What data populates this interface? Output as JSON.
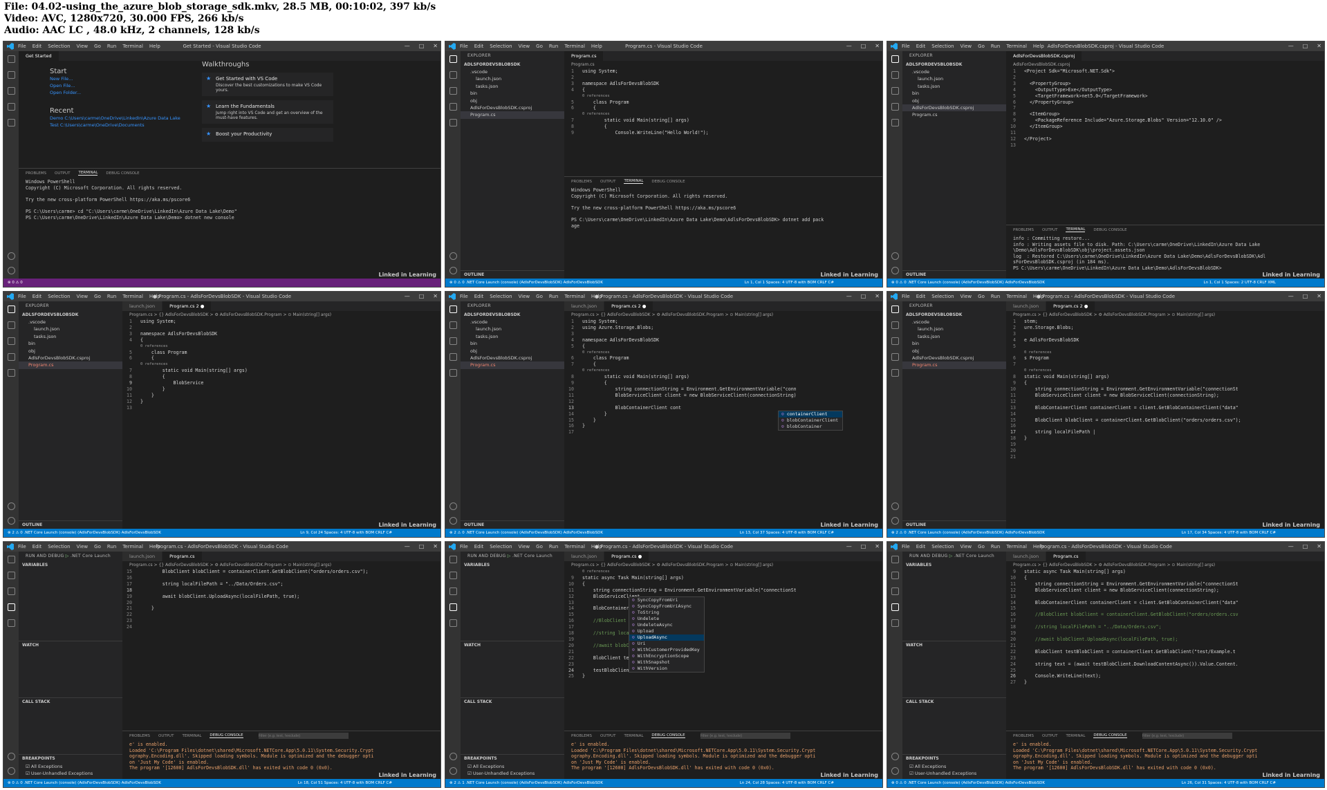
{
  "header": {
    "lines": [
      "File: 04.02-using_the_azure_blob_storage_sdk.mkv, 28.5 MB, 00:10:02, 397 kb/s",
      "Video: AVC, 1280x720, 30.000 FPS, 266 kb/s",
      "Audio: AAC LC , 48.0 kHz, 2 channels, 128 kb/s"
    ]
  },
  "menu": [
    "File",
    "Edit",
    "Selection",
    "View",
    "Go",
    "Run",
    "Terminal",
    "Help"
  ],
  "watermark": "Linked in Learning",
  "panels": [
    {
      "title": "Get Started - Visual Studio Code",
      "tabs": [
        "Get Started"
      ],
      "welcome": {
        "start_heading": "Start",
        "start_links": [
          "New File...",
          "Open File...",
          "Open Folder..."
        ],
        "recent_heading": "Recent",
        "recent": [
          "Demo   C:\\Users\\carme\\OneDrive\\LinkedIn\\Azure Data Lake",
          "Test   C:\\Users\\carme\\OneDrive\\Documents"
        ],
        "walkthroughs_heading": "Walkthroughs",
        "cards": [
          {
            "title": "Get Started with VS Code",
            "desc": "Discover the best customizations to make VS Code yours."
          },
          {
            "title": "Learn the Fundamentals",
            "desc": "Jump right into VS Code and get an overview of the must-have features."
          },
          {
            "title": "Boost your Productivity",
            "desc": ""
          }
        ]
      },
      "panel_tabs": [
        "PROBLEMS",
        "OUTPUT",
        "TERMINAL",
        "DEBUG CONSOLE"
      ],
      "terminal": [
        "Windows PowerShell",
        "Copyright (C) Microsoft Corporation. All rights reserved.",
        "",
        "Try the new cross-platform PowerShell https://aka.ms/pscore6",
        "",
        "PS C:\\Users\\carme> cd \"C:\\Users\\carme\\OneDrive\\LinkedIn\\Azure Data Lake\\Demo\"",
        "PS C:\\Users\\carme\\OneDrive\\LinkedIn\\Azure Data Lake\\Demo> dotnet new console"
      ],
      "status": "⊗ 0 ⚠ 0"
    },
    {
      "title": "Program.cs - Visual Studio Code",
      "explorer_title": "EXPLORER",
      "folder": "ADLSFORDEVSBLOBSDK",
      "files": [
        ".vscode",
        "launch.json",
        "tasks.json",
        "bin",
        "obj",
        "AdlsForDevsBlobSDK.csproj",
        "Program.cs"
      ],
      "tabs": [
        "Program.cs"
      ],
      "breadcrumb": "Program.cs",
      "code": [
        [
          "1",
          "using System;"
        ],
        [
          "2",
          ""
        ],
        [
          "3",
          "namespace AdlsForDevsBlobSDK"
        ],
        [
          "4",
          "{"
        ],
        [
          "",
          "0 references"
        ],
        [
          "5",
          "    class Program"
        ],
        [
          "6",
          "    {"
        ],
        [
          "",
          "0 references"
        ],
        [
          "7",
          "        static void Main(string[] args)"
        ],
        [
          "8",
          "        {"
        ],
        [
          "9",
          "            Console.WriteLine(\"Hello World!\");"
        ]
      ],
      "panel_tabs": [
        "PROBLEMS",
        "OUTPUT",
        "TERMINAL",
        "DEBUG CONSOLE"
      ],
      "terminal": [
        "Windows PowerShell",
        "Copyright (C) Microsoft Corporation. All rights reserved.",
        "",
        "Try the new cross-platform PowerShell https://aka.ms/pscore6",
        "",
        "PS C:\\Users\\carme\\OneDrive\\LinkedIn\\Azure Data Lake\\Demo\\AdlsForDevsBlobSDK> dotnet add pack",
        "age"
      ],
      "outline": "OUTLINE",
      "status": "⊗ 0 ⚠ 0   .NET Core Launch (console) (AdlsForDevsBlobSDK)   AdlsForDevsBlobSDK",
      "status_right": "Ln 1, Col 1   Spaces: 4   UTF-8 with BOM   CRLF   C#"
    },
    {
      "title": "AdlsForDevsBlobSDK.csproj - Visual Studio Code",
      "explorer_title": "EXPLORER",
      "folder": "ADLSFORDEVSBLOBSDK",
      "files": [
        ".vscode",
        "launch.json",
        "tasks.json",
        "bin",
        "obj",
        "AdlsForDevsBlobSDK.csproj",
        "Program.cs"
      ],
      "tabs": [
        "AdlsForDevsBlobSDK.csproj"
      ],
      "breadcrumb": "AdlsForDevsBlobSDK.csproj",
      "code": [
        [
          "1",
          "<Project Sdk=\"Microsoft.NET.Sdk\">"
        ],
        [
          "2",
          ""
        ],
        [
          "3",
          "  <PropertyGroup>"
        ],
        [
          "4",
          "    <OutputType>Exe</OutputType>"
        ],
        [
          "5",
          "    <TargetFramework>net5.0</TargetFramework>"
        ],
        [
          "6",
          "  </PropertyGroup>"
        ],
        [
          "7",
          ""
        ],
        [
          "8",
          "  <ItemGroup>"
        ],
        [
          "9",
          "    <PackageReference Include=\"Azure.Storage.Blobs\" Version=\"12.10.0\" />"
        ],
        [
          "10",
          "  </ItemGroup>"
        ],
        [
          "11",
          ""
        ],
        [
          "12",
          "</Project>"
        ],
        [
          "13",
          ""
        ]
      ],
      "panel_tabs": [
        "PROBLEMS",
        "OUTPUT",
        "TERMINAL",
        "DEBUG CONSOLE"
      ],
      "terminal": [
        "info : Committing restore...",
        "info : Writing assets file to disk. Path: C:\\Users\\carme\\OneDrive\\LinkedIn\\Azure Data Lake",
        "\\Demo\\AdlsForDevsBlobSDK\\obj\\project.assets.json",
        "log  : Restored C:\\Users\\carme\\OneDrive\\LinkedIn\\Azure Data Lake\\Demo\\AdlsForDevsBlobSDK\\Adl",
        "sForDevsBlobSDK.csproj (in 184 ms).",
        "PS C:\\Users\\carme\\OneDrive\\LinkedIn\\Azure Data Lake\\Demo\\AdlsForDevsBlobSDK>"
      ],
      "outline": "OUTLINE",
      "status": "⊗ 0 ⚠ 0   .NET Core Launch (console) (AdlsForDevsBlobSDK)   AdlsForDevsBlobSDK",
      "status_right": "Ln 1, Col 1   Spaces: 2   UTF-8   CRLF   XML"
    },
    {
      "title": "● Program.cs - AdlsForDevsBlobSDK - Visual Studio Code",
      "explorer_title": "EXPLORER",
      "folder": "ADLSFORDEVSBLOBSDK",
      "files": [
        ".vscode",
        "launch.json",
        "tasks.json",
        "bin",
        "obj",
        "AdlsForDevsBlobSDK.csproj",
        "Program.cs"
      ],
      "tabs": [
        "launch.json",
        "Program.cs 2 ●"
      ],
      "breadcrumb": "Program.cs > {} AdlsForDevsBlobSDK > ⚙ AdlsForDevsBlobSDK.Program > ⊙ Main(string[] args)",
      "code": [
        [
          "1",
          "using System;"
        ],
        [
          "2",
          ""
        ],
        [
          "3",
          "namespace AdlsForDevsBlobSDK"
        ],
        [
          "4",
          "{"
        ],
        [
          "",
          "0 references"
        ],
        [
          "5",
          "    class Program"
        ],
        [
          "6",
          "    {"
        ],
        [
          "",
          "0 references"
        ],
        [
          "7",
          "        static void Main(string[] args)"
        ],
        [
          "8",
          "        {"
        ],
        [
          "9",
          "            BlobService"
        ],
        [
          "10",
          "        }"
        ],
        [
          "11",
          "    }"
        ],
        [
          "12",
          "}"
        ],
        [
          "13",
          ""
        ]
      ],
      "outline": "OUTLINE",
      "status": "⊗ 2 ⚠ 0   .NET Core Launch (console) (AdlsForDevsBlobSDK)   AdlsForDevsBlobSDK",
      "status_right": "Ln 9, Col 24   Spaces: 4   UTF-8 with BOM   CRLF   C#"
    },
    {
      "title": "● Program.cs - AdlsForDevsBlobSDK - Visual Studio Code",
      "explorer_title": "EXPLORER",
      "folder": "ADLSFORDEVSBLOBSDK",
      "files": [
        ".vscode",
        "launch.json",
        "tasks.json",
        "bin",
        "obj",
        "AdlsForDevsBlobSDK.csproj",
        "Program.cs"
      ],
      "tabs": [
        "launch.json",
        "Program.cs 2 ●"
      ],
      "breadcrumb": "Program.cs > {} AdlsForDevsBlobSDK > ⚙ AdlsForDevsBlobSDK.Program > ⊙ Main(string[] args)",
      "code": [
        [
          "1",
          "using System;"
        ],
        [
          "2",
          "using Azure.Storage.Blobs;"
        ],
        [
          "3",
          ""
        ],
        [
          "4",
          "namespace AdlsForDevsBlobSDK"
        ],
        [
          "5",
          "{"
        ],
        [
          "",
          "0 references"
        ],
        [
          "6",
          "    class Program"
        ],
        [
          "7",
          "    {"
        ],
        [
          "",
          "0 references"
        ],
        [
          "8",
          "        static void Main(string[] args)"
        ],
        [
          "9",
          "        {"
        ],
        [
          "10",
          "            string connectionString = Environment.GetEnvironmentVariable(\"conn"
        ],
        [
          "11",
          "            BlobServiceClient client = new BlobServiceClient(connectionString)"
        ],
        [
          "12",
          ""
        ],
        [
          "13",
          "            BlobContainerClient cont"
        ],
        [
          "14",
          "        }"
        ],
        [
          "15",
          "    }"
        ],
        [
          "16",
          "}"
        ],
        [
          "17",
          ""
        ]
      ],
      "suggest": [
        "containerClient",
        "blobContainerClient",
        "blobContainer"
      ],
      "outline": "OUTLINE",
      "status": "⊗ 2 ⚠ 0   .NET Core Launch (console) (AdlsForDevsBlobSDK)   AdlsForDevsBlobSDK",
      "status_right": "Ln 13, Col 37   Spaces: 4   UTF-8 with BOM   CRLF   C#"
    },
    {
      "title": "● Program.cs - AdlsForDevsBlobSDK - Visual Studio Code",
      "explorer_title": "EXPLORER",
      "folder": "ADLSFORDEVSBLOBSDK",
      "files": [
        ".vscode",
        "launch.json",
        "tasks.json",
        "bin",
        "obj",
        "AdlsForDevsBlobSDK.csproj",
        "Program.cs"
      ],
      "tabs": [
        "launch.json",
        "Program.cs 2 ●"
      ],
      "breadcrumb": "Program.cs > {} AdlsForDevsBlobSDK > ⚙ AdlsForDevsBlobSDK.Program > ⊙ Main(string[] args)",
      "code": [
        [
          "1",
          "stem;"
        ],
        [
          "2",
          "ure.Storage.Blobs;"
        ],
        [
          "3",
          ""
        ],
        [
          "4",
          "e AdlsForDevsBlobSDK"
        ],
        [
          "5",
          ""
        ],
        [
          "",
          "0 references"
        ],
        [
          "6",
          "s Program"
        ],
        [
          "7",
          ""
        ],
        [
          "",
          "0 references"
        ],
        [
          "8",
          "static void Main(string[] args)"
        ],
        [
          "9",
          "{"
        ],
        [
          "10",
          "    string connectionString = Environment.GetEnvironmentVariable(\"connectionSt"
        ],
        [
          "11",
          "    BlobServiceClient client = new BlobServiceClient(connectionString);"
        ],
        [
          "12",
          ""
        ],
        [
          "13",
          "    BlobContainerClient containerClient = client.GetBlobContainerClient(\"data\""
        ],
        [
          "14",
          ""
        ],
        [
          "15",
          "    BlobClient blobClient = containerClient.GetBlobClient(\"orders/orders.csv\");"
        ],
        [
          "16",
          ""
        ],
        [
          "17",
          "    string localFilePath |"
        ],
        [
          "18",
          "}"
        ],
        [
          "19",
          ""
        ],
        [
          "20",
          ""
        ],
        [
          "21",
          ""
        ]
      ],
      "outline": "OUTLINE",
      "status": "⊗ 2 ⚠ 0   .NET Core Launch (console) (AdlsForDevsBlobSDK)   AdlsForDevsBlobSDK",
      "status_right": "Ln 17, Col 34   Spaces: 4   UTF-8 with BOM   CRLF   C#"
    },
    {
      "title": "Program.cs - AdlsForDevsBlobSDK - Visual Studio Code",
      "debug_title": "RUN AND DEBUG",
      "debug_config": ".NET Core Launch",
      "debug_sections": [
        "VARIABLES",
        "WATCH",
        "CALL STACK",
        "BREAKPOINTS"
      ],
      "breakpoints": [
        "All Exceptions",
        "User-Unhandled Exceptions"
      ],
      "tabs": [
        "launch.json",
        "Program.cs"
      ],
      "breadcrumb": "Program.cs > {} AdlsForDevsBlobSDK > ⚙ AdlsForDevsBlobSDK.Program > ⊙ Main(string[] args)",
      "code": [
        [
          "15",
          "        BlobClient blobClient = containerClient.GetBlobClient(\"orders/orders.csv\");"
        ],
        [
          "16",
          ""
        ],
        [
          "17",
          "        string localFilePath = \"../Data/Orders.csv\";"
        ],
        [
          "18",
          ""
        ],
        [
          "19",
          "        await blobClient.UploadAsync(localFilePath, true);"
        ],
        [
          "20",
          ""
        ],
        [
          "21",
          "    }"
        ],
        [
          "22",
          ""
        ],
        [
          "23",
          ""
        ],
        [
          "24",
          ""
        ]
      ],
      "panel_tabs": [
        "PROBLEMS",
        "OUTPUT",
        "TERMINAL",
        "DEBUG CONSOLE"
      ],
      "filter": "Filter (e.g. text, !exclude)",
      "terminal": [
        "e' is enabled.",
        "Loaded 'C:\\Program Files\\dotnet\\shared\\Microsoft.NETCore.App\\5.0.11\\System.Security.Crypt",
        "ography.Encoding.dll'. Skipped loading symbols. Module is optimized and the debugger opti",
        "on 'Just My Code' is enabled.",
        "The program '[12600] AdlsForDevsBlobSDK.dll' has exited with code 0 (0x0)."
      ],
      "status": "⊗ 0 ⚠ 0   .NET Core Launch (console) (AdlsForDevsBlobSDK)   AdlsForDevsBlobSDK",
      "status_right": "Ln 18, Col 51   Spaces: 4   UTF-8 with BOM   CRLF   C#"
    },
    {
      "title": "● Program.cs - AdlsForDevsBlobSDK - Visual Studio Code",
      "debug_title": "RUN AND DEBUG",
      "debug_config": ".NET Core Launch",
      "debug_sections": [
        "VARIABLES",
        "WATCH",
        "CALL STACK",
        "BREAKPOINTS"
      ],
      "breakpoints": [
        "All Exceptions",
        "User-Unhandled Exceptions"
      ],
      "tabs": [
        "launch.json",
        "Program.cs ●"
      ],
      "breadcrumb": "Program.cs > {} AdlsForDevsBlobSDK > ⚙ AdlsForDevsBlobSDK.Program > ⊙ Main(string[] args)",
      "code": [
        [
          "",
          "0 references"
        ],
        [
          "9",
          "static async Task Main(string[] args)"
        ],
        [
          "10",
          "{"
        ],
        [
          "11",
          "    string connectionString = Environment.GetEnvironmentVariable(\"connectionSt"
        ],
        [
          "12",
          "    BlobServiceClient"
        ],
        [
          "13",
          ""
        ],
        [
          "14",
          "    BlobContainerCl"
        ],
        [
          "15",
          ""
        ],
        [
          "16",
          "    //BlobClient bl"
        ],
        [
          "17",
          ""
        ],
        [
          "18",
          "    //string local"
        ],
        [
          "19",
          ""
        ],
        [
          "20",
          "    //await blobCl"
        ],
        [
          "21",
          ""
        ],
        [
          "22",
          "    BlobClient test"
        ],
        [
          "23",
          ""
        ],
        [
          "24",
          "    testBlobClient."
        ],
        [
          "25",
          "}"
        ]
      ],
      "suggest": [
        "SyncCopyFromUri",
        "SyncCopyFromUriAsync",
        "ToString",
        "Undelete",
        "UndeleteAsync",
        "Upload",
        "UploadAsync",
        "Uri",
        "WithCustomerProvidedKey",
        "WithEncryptionScope",
        "WithSnapshot",
        "WithVersion"
      ],
      "panel_tabs": [
        "PROBLEMS",
        "OUTPUT",
        "TERMINAL",
        "DEBUG CONSOLE"
      ],
      "filter": "Filter (e.g. text, !exclude)",
      "terminal": [
        "e' is enabled.",
        "Loaded 'C:\\Program Files\\dotnet\\shared\\Microsoft.NETCore.App\\5.0.11\\System.Security.Crypt",
        "ography.Encoding.dll'. Skipped loading symbols. Module is optimized and the debugger opti",
        "on 'Just My Code' is enabled.",
        "The program '[12600] AdlsForDevsBlobSDK.dll' has exited with code 0 (0x0)."
      ],
      "status": "⊗ 2 ⚠ 1   .NET Core Launch (console) (AdlsForDevsBlobSDK)   AdlsForDevsBlobSDK",
      "status_right": "Ln 24, Col 28   Spaces: 4   UTF-8 with BOM   CRLF   C#"
    },
    {
      "title": "Program.cs - AdlsForDevsBlobSDK - Visual Studio Code",
      "debug_title": "RUN AND DEBUG",
      "debug_config": ".NET Core Launch",
      "debug_sections": [
        "VARIABLES",
        "WATCH",
        "CALL STACK",
        "BREAKPOINTS"
      ],
      "breakpoints": [
        "All Exceptions",
        "User-Unhandled Exceptions"
      ],
      "tabs": [
        "launch.json",
        "Program.cs"
      ],
      "breadcrumb": "Program.cs > {} AdlsForDevsBlobSDK > ⚙ AdlsForDevsBlobSDK.Program > ⊙ Main(string[] args)",
      "code": [
        [
          "9",
          "static async Task Main(string[] args)"
        ],
        [
          "10",
          "{"
        ],
        [
          "11",
          "    string connectionString = Environment.GetEnvironmentVariable(\"connectionSt"
        ],
        [
          "12",
          "    BlobServiceClient client = new BlobServiceClient(connectionString);"
        ],
        [
          "13",
          ""
        ],
        [
          "14",
          "    BlobContainerClient containerClient = client.GetBlobContainerClient(\"data\""
        ],
        [
          "15",
          ""
        ],
        [
          "16",
          "    //BlobClient blobClient = containerClient.GetBlobClient(\"orders/orders.csv"
        ],
        [
          "17",
          ""
        ],
        [
          "18",
          "    //string localFilePath = \"../Data/Orders.csv\";"
        ],
        [
          "19",
          ""
        ],
        [
          "20",
          "    //await blobClient.UploadAsync(localFilePath, true);"
        ],
        [
          "21",
          ""
        ],
        [
          "22",
          "    BlobClient testBlobClient = containerClient.GetBlobClient(\"test/Example.t"
        ],
        [
          "23",
          ""
        ],
        [
          "24",
          "    string text = (await testBlobClient.DownloadContentAsync()).Value.Content."
        ],
        [
          "25",
          ""
        ],
        [
          "26",
          "    Console.WriteLine(text);"
        ],
        [
          "27",
          "}"
        ]
      ],
      "panel_tabs": [
        "PROBLEMS",
        "OUTPUT",
        "TERMINAL",
        "DEBUG CONSOLE"
      ],
      "filter": "Filter (e.g. text, !exclude)",
      "terminal": [
        "e' is enabled.",
        "Loaded 'C:\\Program Files\\dotnet\\shared\\Microsoft.NETCore.App\\5.0.11\\System.Security.Crypt",
        "ography.Encoding.dll'. Skipped loading symbols. Module is optimized and the debugger opti",
        "on 'Just My Code' is enabled.",
        "The program '[12600] AdlsForDevsBlobSDK.dll' has exited with code 0 (0x0)."
      ],
      "status": "⊗ 0 ⚠ 0   .NET Core Launch (console) (AdlsForDevsBlobSDK)   AdlsForDevsBlobSDK",
      "status_right": "Ln 26, Col 31   Spaces: 4   UTF-8 with BOM   CRLF   C#"
    }
  ]
}
